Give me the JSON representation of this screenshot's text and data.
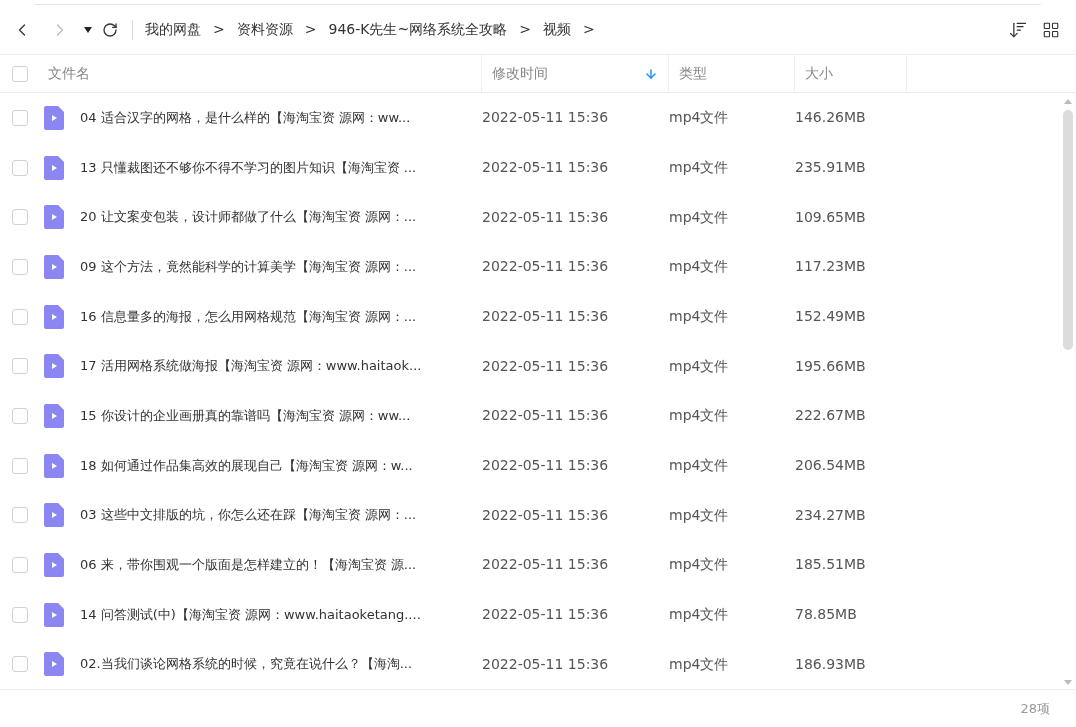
{
  "breadcrumb": [
    "我的网盘",
    "资料资源",
    "946-K先生~网络系统全攻略",
    "视频"
  ],
  "separator": ">",
  "header": {
    "checked": false,
    "columns": [
      {
        "label": "文件名",
        "sorted": false
      },
      {
        "label": "修改时间",
        "sorted": true
      },
      {
        "label": "类型",
        "sorted": false
      },
      {
        "label": "大小",
        "sorted": false
      }
    ]
  },
  "rows": [
    {
      "name": "04 适合汉字的网格，是什么样的【海淘宝资 源网：ww...",
      "modified": "2022-05-11 15:36",
      "type": "mp4文件",
      "size": "146.26MB",
      "checked": false
    },
    {
      "name": "13 只懂裁图还不够你不得不学习的图片知识【海淘宝资 ...",
      "modified": "2022-05-11 15:36",
      "type": "mp4文件",
      "size": "235.91MB",
      "checked": false
    },
    {
      "name": "20 让文案变包装，设计师都做了什么【海淘宝资 源网：...",
      "modified": "2022-05-11 15:36",
      "type": "mp4文件",
      "size": "109.65MB",
      "checked": false
    },
    {
      "name": "09 这个方法，竟然能科学的计算美学【海淘宝资 源网：...",
      "modified": "2022-05-11 15:36",
      "type": "mp4文件",
      "size": "117.23MB",
      "checked": false
    },
    {
      "name": "16 信息量多的海报，怎么用网格规范【海淘宝资 源网：...",
      "modified": "2022-05-11 15:36",
      "type": "mp4文件",
      "size": "152.49MB",
      "checked": false
    },
    {
      "name": "17 活用网格系统做海报【海淘宝资 源网：www.haitaok...",
      "modified": "2022-05-11 15:36",
      "type": "mp4文件",
      "size": "195.66MB",
      "checked": false
    },
    {
      "name": "15 你设计的企业画册真的靠谱吗【海淘宝资 源网：ww...",
      "modified": "2022-05-11 15:36",
      "type": "mp4文件",
      "size": "222.67MB",
      "checked": false
    },
    {
      "name": "18 如何通过作品集高效的展现自己【海淘宝资 源网：w...",
      "modified": "2022-05-11 15:36",
      "type": "mp4文件",
      "size": "206.54MB",
      "checked": false
    },
    {
      "name": "03 这些中文排版的坑，你怎么还在踩【海淘宝资 源网：...",
      "modified": "2022-05-11 15:36",
      "type": "mp4文件",
      "size": "234.27MB",
      "checked": false
    },
    {
      "name": "06 来，带你围观一个版面是怎样建立的！【海淘宝资 源...",
      "modified": "2022-05-11 15:36",
      "type": "mp4文件",
      "size": "185.51MB",
      "checked": false
    },
    {
      "name": "14 问答测试(中)【海淘宝资 源网：www.haitaoketang....",
      "modified": "2022-05-11 15:36",
      "type": "mp4文件",
      "size": "78.85MB",
      "checked": false
    },
    {
      "name": "02.当我们谈论网格系统的时候，究竟在说什么？【海淘...",
      "modified": "2022-05-11 15:36",
      "type": "mp4文件",
      "size": "186.93MB",
      "checked": false
    }
  ],
  "status_bar": {
    "count": "28项"
  }
}
